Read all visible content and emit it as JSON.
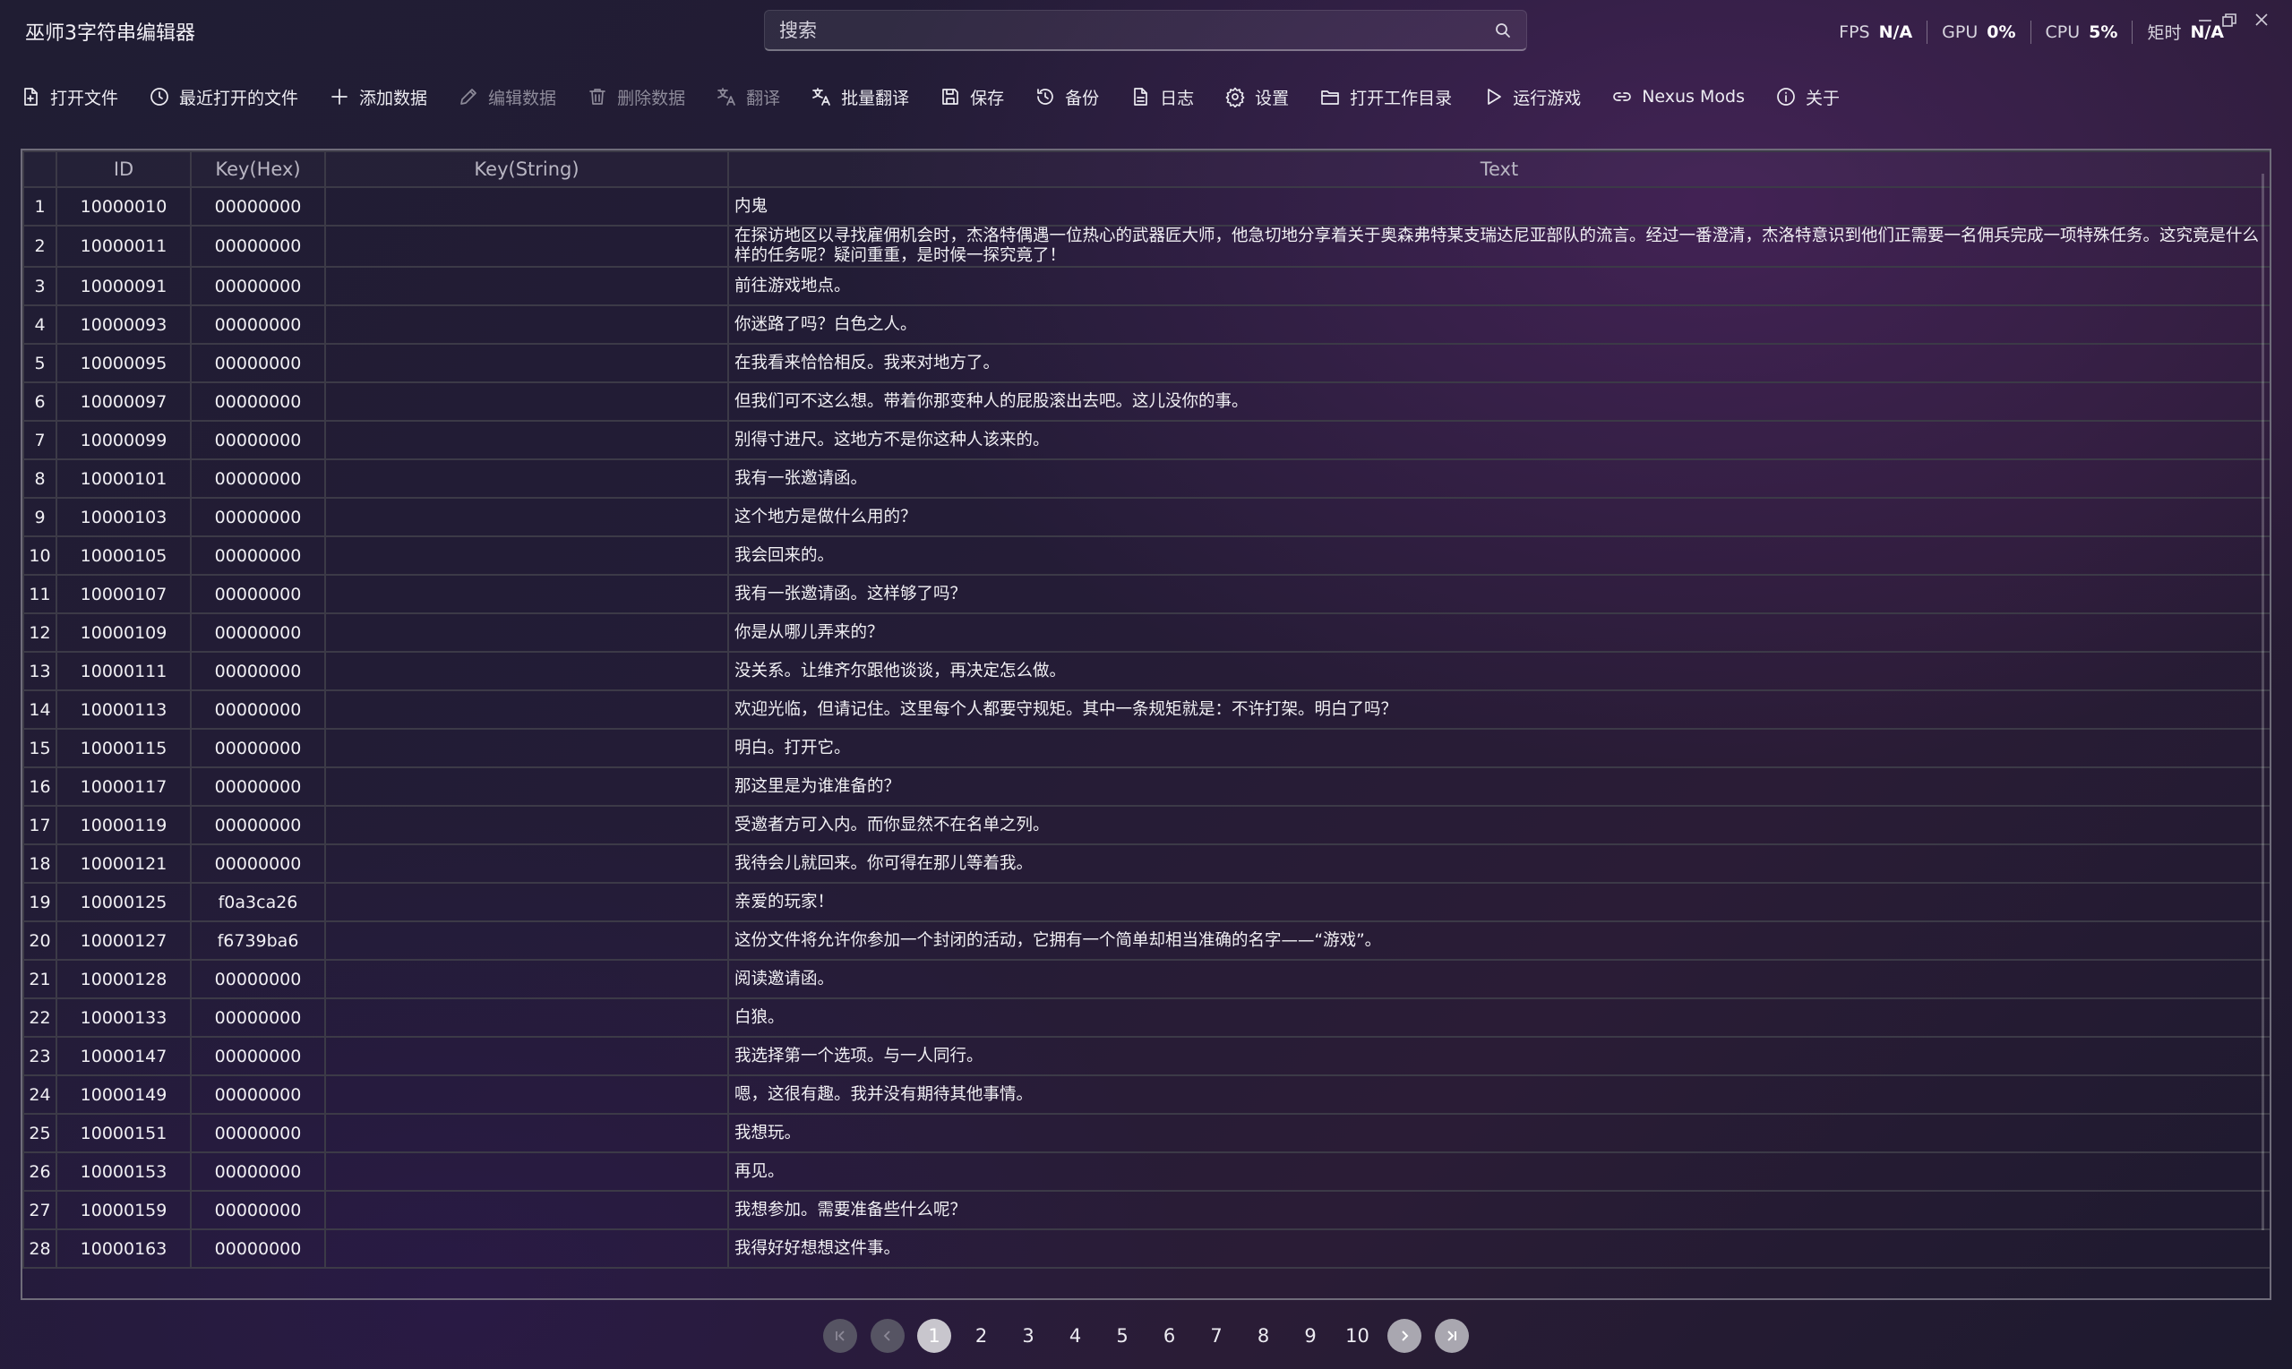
{
  "app": {
    "title": "巫师3字符串编辑器"
  },
  "search": {
    "placeholder": "搜索"
  },
  "stats": {
    "fps_label": "FPS",
    "fps_value": "N/A",
    "gpu_label": "GPU",
    "gpu_value": "0%",
    "cpu_label": "CPU",
    "cpu_value": "5%",
    "mem_label": "矩时",
    "mem_value": "N/A"
  },
  "toolbar": {
    "open_file": "打开文件",
    "recent_files": "最近打开的文件",
    "add_data": "添加数据",
    "edit_data": "编辑数据",
    "delete_data": "删除数据",
    "translate": "翻译",
    "batch_translate": "批量翻译",
    "save": "保存",
    "backup": "备份",
    "log": "日志",
    "settings": "设置",
    "open_work_dir": "打开工作目录",
    "run_game": "运行游戏",
    "nexus_mods": "Nexus Mods",
    "about": "关于"
  },
  "table": {
    "headers": {
      "row": "",
      "id": "ID",
      "hex": "Key(Hex)",
      "string": "Key(String)",
      "text": "Text"
    },
    "rows": [
      {
        "n": "1",
        "id": "10000010",
        "hex": "00000000",
        "str": "",
        "text": "内鬼"
      },
      {
        "n": "2",
        "id": "10000011",
        "hex": "00000000",
        "str": "",
        "text": "在探访地区以寻找雇佣机会时，杰洛特偶遇一位热心的武器匠大师，他急切地分享着关于奥森弗特某支瑞达尼亚部队的流言。经过一番澄清，杰洛特意识到他们正需要一名佣兵完成一项特殊任务。这究竟是什么样的任务呢？疑问重重，是时候一探究竟了！"
      },
      {
        "n": "3",
        "id": "10000091",
        "hex": "00000000",
        "str": "",
        "text": "前往游戏地点。"
      },
      {
        "n": "4",
        "id": "10000093",
        "hex": "00000000",
        "str": "",
        "text": "你迷路了吗？白色之人。"
      },
      {
        "n": "5",
        "id": "10000095",
        "hex": "00000000",
        "str": "",
        "text": "在我看来恰恰相反。我来对地方了。"
      },
      {
        "n": "6",
        "id": "10000097",
        "hex": "00000000",
        "str": "",
        "text": "但我们可不这么想。带着你那变种人的屁股滚出去吧。这儿没你的事。"
      },
      {
        "n": "7",
        "id": "10000099",
        "hex": "00000000",
        "str": "",
        "text": "别得寸进尺。这地方不是你这种人该来的。"
      },
      {
        "n": "8",
        "id": "10000101",
        "hex": "00000000",
        "str": "",
        "text": "我有一张邀请函。"
      },
      {
        "n": "9",
        "id": "10000103",
        "hex": "00000000",
        "str": "",
        "text": "这个地方是做什么用的？"
      },
      {
        "n": "10",
        "id": "10000105",
        "hex": "00000000",
        "str": "",
        "text": "我会回来的。"
      },
      {
        "n": "11",
        "id": "10000107",
        "hex": "00000000",
        "str": "",
        "text": "我有一张邀请函。这样够了吗？"
      },
      {
        "n": "12",
        "id": "10000109",
        "hex": "00000000",
        "str": "",
        "text": "你是从哪儿弄来的？"
      },
      {
        "n": "13",
        "id": "10000111",
        "hex": "00000000",
        "str": "",
        "text": "没关系。让维齐尔跟他谈谈，再决定怎么做。"
      },
      {
        "n": "14",
        "id": "10000113",
        "hex": "00000000",
        "str": "",
        "text": "欢迎光临，但请记住。这里每个人都要守规矩。其中一条规矩就是：不许打架。明白了吗？"
      },
      {
        "n": "15",
        "id": "10000115",
        "hex": "00000000",
        "str": "",
        "text": "明白。打开它。"
      },
      {
        "n": "16",
        "id": "10000117",
        "hex": "00000000",
        "str": "",
        "text": "那这里是为谁准备的？"
      },
      {
        "n": "17",
        "id": "10000119",
        "hex": "00000000",
        "str": "",
        "text": "受邀者方可入内。而你显然不在名单之列。"
      },
      {
        "n": "18",
        "id": "10000121",
        "hex": "00000000",
        "str": "",
        "text": "我待会儿就回来。你可得在那儿等着我。"
      },
      {
        "n": "19",
        "id": "10000125",
        "hex": "f0a3ca26",
        "str": "",
        "text": "亲爱的玩家！"
      },
      {
        "n": "20",
        "id": "10000127",
        "hex": "f6739ba6",
        "str": "",
        "text": "这份文件将允许你参加一个封闭的活动，它拥有一个简单却相当准确的名字——“游戏”。"
      },
      {
        "n": "21",
        "id": "10000128",
        "hex": "00000000",
        "str": "",
        "text": "阅读邀请函。"
      },
      {
        "n": "22",
        "id": "10000133",
        "hex": "00000000",
        "str": "",
        "text": "白狼。"
      },
      {
        "n": "23",
        "id": "10000147",
        "hex": "00000000",
        "str": "",
        "text": "我选择第一个选项。与一人同行。"
      },
      {
        "n": "24",
        "id": "10000149",
        "hex": "00000000",
        "str": "",
        "text": "嗯，这很有趣。我并没有期待其他事情。"
      },
      {
        "n": "25",
        "id": "10000151",
        "hex": "00000000",
        "str": "",
        "text": "我想玩。"
      },
      {
        "n": "26",
        "id": "10000153",
        "hex": "00000000",
        "str": "",
        "text": "再见。"
      },
      {
        "n": "27",
        "id": "10000159",
        "hex": "00000000",
        "str": "",
        "text": "我想参加。需要准备些什么呢？"
      },
      {
        "n": "28",
        "id": "10000163",
        "hex": "00000000",
        "str": "",
        "text": "我得好好想想这件事。"
      }
    ]
  },
  "pager": {
    "pages": [
      "1",
      "2",
      "3",
      "4",
      "5",
      "6",
      "7",
      "8",
      "9",
      "10"
    ],
    "current": "1"
  }
}
